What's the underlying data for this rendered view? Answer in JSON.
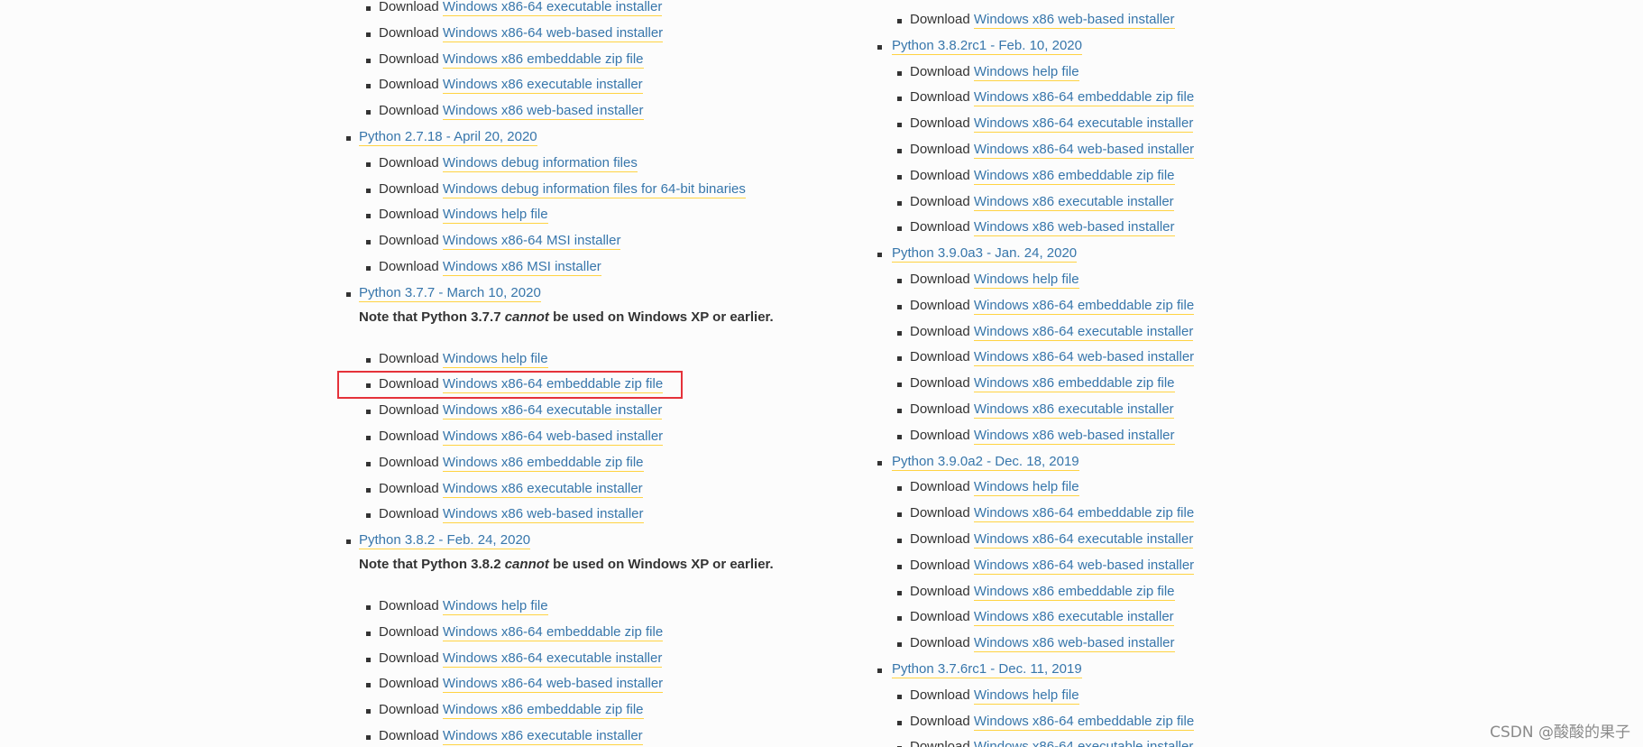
{
  "prefix": "Download",
  "note_words": {
    "before": "Note that Python",
    "italic": "cannot",
    "after": "be used on Windows XP or earlier."
  },
  "colors": {
    "link": "#3776ab",
    "link_underline": "#ffd343",
    "text": "#333333",
    "highlight_border": "#e5323a"
  },
  "left_column": [
    {
      "type": "dl",
      "label": "Windows x86-64 executable installer"
    },
    {
      "type": "dl",
      "label": "Windows x86-64 web-based installer"
    },
    {
      "type": "dl",
      "label": "Windows x86 embeddable zip file"
    },
    {
      "type": "dl",
      "label": "Windows x86 executable installer"
    },
    {
      "type": "dl",
      "label": "Windows x86 web-based installer"
    },
    {
      "type": "release",
      "label": "Python 2.7.18 - April 20, 2020"
    },
    {
      "type": "dl",
      "label": "Windows debug information files"
    },
    {
      "type": "dl",
      "label": "Windows debug information files for 64-bit binaries"
    },
    {
      "type": "dl",
      "label": "Windows help file"
    },
    {
      "type": "dl",
      "label": "Windows x86-64 MSI installer"
    },
    {
      "type": "dl",
      "label": "Windows x86 MSI installer"
    },
    {
      "type": "release",
      "label": "Python 3.7.7 - March 10, 2020"
    },
    {
      "type": "note",
      "version": "3.7.7"
    },
    {
      "type": "dl",
      "label": "Windows help file"
    },
    {
      "type": "dl",
      "label": "Windows x86-64 embeddable zip file",
      "highlighted": true
    },
    {
      "type": "dl",
      "label": "Windows x86-64 executable installer"
    },
    {
      "type": "dl",
      "label": "Windows x86-64 web-based installer"
    },
    {
      "type": "dl",
      "label": "Windows x86 embeddable zip file"
    },
    {
      "type": "dl",
      "label": "Windows x86 executable installer"
    },
    {
      "type": "dl",
      "label": "Windows x86 web-based installer"
    },
    {
      "type": "release",
      "label": "Python 3.8.2 - Feb. 24, 2020"
    },
    {
      "type": "note",
      "version": "3.8.2"
    },
    {
      "type": "dl",
      "label": "Windows help file"
    },
    {
      "type": "dl",
      "label": "Windows x86-64 embeddable zip file"
    },
    {
      "type": "dl",
      "label": "Windows x86-64 executable installer"
    },
    {
      "type": "dl",
      "label": "Windows x86-64 web-based installer"
    },
    {
      "type": "dl",
      "label": "Windows x86 embeddable zip file"
    },
    {
      "type": "dl",
      "label": "Windows x86 executable installer"
    }
  ],
  "right_column": [
    {
      "type": "dl",
      "label": "Windows x86 web-based installer"
    },
    {
      "type": "release",
      "label": "Python 3.8.2rc1 - Feb. 10, 2020"
    },
    {
      "type": "dl",
      "label": "Windows help file"
    },
    {
      "type": "dl",
      "label": "Windows x86-64 embeddable zip file"
    },
    {
      "type": "dl",
      "label": "Windows x86-64 executable installer"
    },
    {
      "type": "dl",
      "label": "Windows x86-64 web-based installer"
    },
    {
      "type": "dl",
      "label": "Windows x86 embeddable zip file"
    },
    {
      "type": "dl",
      "label": "Windows x86 executable installer"
    },
    {
      "type": "dl",
      "label": "Windows x86 web-based installer"
    },
    {
      "type": "release",
      "label": "Python 3.9.0a3 - Jan. 24, 2020"
    },
    {
      "type": "dl",
      "label": "Windows help file"
    },
    {
      "type": "dl",
      "label": "Windows x86-64 embeddable zip file"
    },
    {
      "type": "dl",
      "label": "Windows x86-64 executable installer"
    },
    {
      "type": "dl",
      "label": "Windows x86-64 web-based installer"
    },
    {
      "type": "dl",
      "label": "Windows x86 embeddable zip file"
    },
    {
      "type": "dl",
      "label": "Windows x86 executable installer"
    },
    {
      "type": "dl",
      "label": "Windows x86 web-based installer"
    },
    {
      "type": "release",
      "label": "Python 3.9.0a2 - Dec. 18, 2019"
    },
    {
      "type": "dl",
      "label": "Windows help file"
    },
    {
      "type": "dl",
      "label": "Windows x86-64 embeddable zip file"
    },
    {
      "type": "dl",
      "label": "Windows x86-64 executable installer"
    },
    {
      "type": "dl",
      "label": "Windows x86-64 web-based installer"
    },
    {
      "type": "dl",
      "label": "Windows x86 embeddable zip file"
    },
    {
      "type": "dl",
      "label": "Windows x86 executable installer"
    },
    {
      "type": "dl",
      "label": "Windows x86 web-based installer"
    },
    {
      "type": "release",
      "label": "Python 3.7.6rc1 - Dec. 11, 2019"
    },
    {
      "type": "dl",
      "label": "Windows help file"
    },
    {
      "type": "dl",
      "label": "Windows x86-64 embeddable zip file"
    },
    {
      "type": "dl",
      "label": "Windows x86-64 executable installer"
    }
  ],
  "watermark": "CSDN @酸酸的果子"
}
